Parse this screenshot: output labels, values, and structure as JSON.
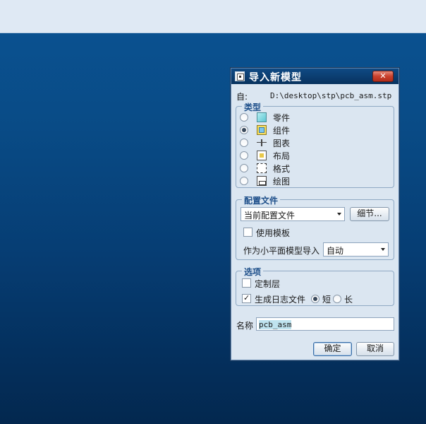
{
  "dialog": {
    "title": "导入新模型",
    "close_label": "✕",
    "from_label": "自:",
    "from_path": "D:\\desktop\\stp\\pcb_asm.stp"
  },
  "type_group": {
    "title": "类型",
    "items": [
      {
        "label": "零件",
        "icon": "part-icon",
        "selected": false
      },
      {
        "label": "组件",
        "icon": "assembly-icon",
        "selected": true
      },
      {
        "label": "图表",
        "icon": "diagram-icon",
        "selected": false
      },
      {
        "label": "布局",
        "icon": "layout-icon",
        "selected": false
      },
      {
        "label": "格式",
        "icon": "format-icon",
        "selected": false
      },
      {
        "label": "绘图",
        "icon": "drawing-icon",
        "selected": false
      }
    ]
  },
  "config_group": {
    "title": "配置文件",
    "profile_value": "当前配置文件",
    "details_label": "细节...",
    "use_template_label": "使用模板",
    "use_template_checked": false,
    "import_as_label": "作为小平面模型导入",
    "import_as_value": "自动"
  },
  "options_group": {
    "title": "选项",
    "custom_layer_label": "定制层",
    "custom_layer_checked": false,
    "log_file_label": "生成日志文件",
    "log_file_checked": true,
    "short_label": "短",
    "long_label": "长",
    "log_mode": "short"
  },
  "name_field": {
    "label": "名称",
    "value": "pcb_asm"
  },
  "footer": {
    "ok_label": "确定",
    "cancel_label": "取消"
  },
  "colors": {
    "titlebar": "#0b3d70",
    "dialog_bg": "#dbe6f1",
    "group_title": "#1e4f8a",
    "desktop": "#094b86"
  }
}
